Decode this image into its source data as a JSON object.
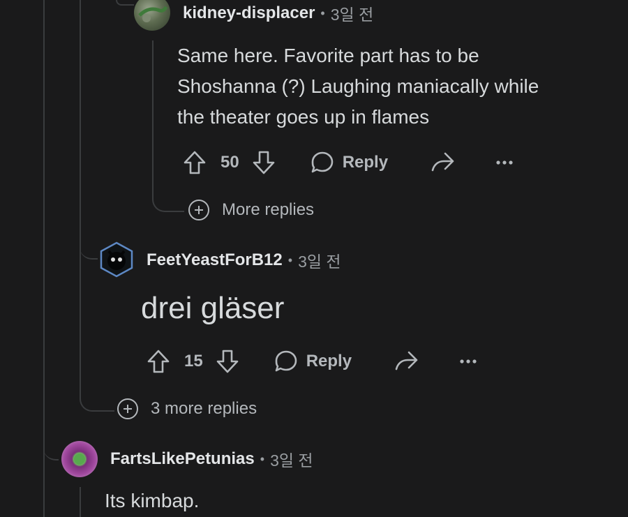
{
  "comments": [
    {
      "username": "kidney-displacer",
      "time": "3일 전",
      "body": [
        "Same here. Favorite part has to be",
        "Shoshanna (?) Laughing maniacally while",
        "the theater goes up in flames"
      ],
      "votes": "50",
      "reply_label": "Reply"
    },
    {
      "username": "FeetYeastForB12",
      "time": "3일 전",
      "body": [
        "drei gläser"
      ],
      "votes": "15",
      "reply_label": "Reply"
    },
    {
      "username": "FartsLikePetunias",
      "time": "3일 전",
      "body": [
        "Its kimbap."
      ]
    }
  ],
  "more_replies_1": "More replies",
  "more_replies_2": "3 more replies",
  "separator": "•",
  "icons": {
    "upvote": "arrow-up-icon",
    "downvote": "arrow-down-icon",
    "reply": "speech-bubble-icon",
    "share": "share-icon",
    "overflow": "more-dots-icon",
    "expand": "plus-circle-icon"
  },
  "colors": {
    "background": "#1a1a1b",
    "thread_line": "#3a3c3e",
    "text": "#d7dadc",
    "muted": "#9a9ea2"
  }
}
